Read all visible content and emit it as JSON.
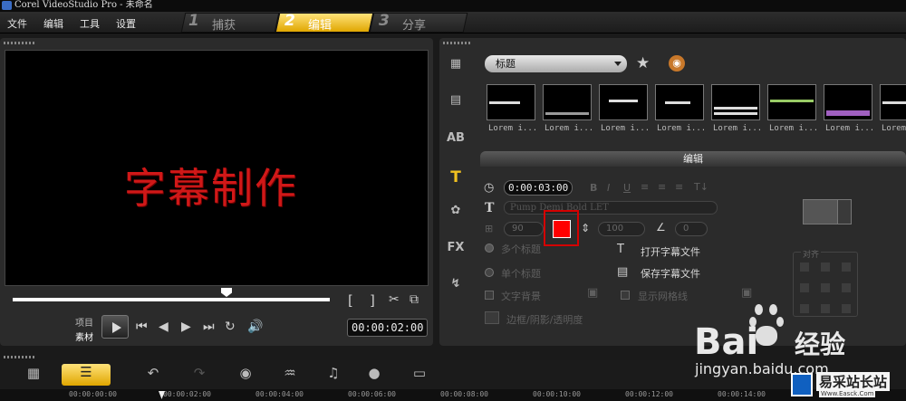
{
  "window": {
    "title": "Corel VideoStudio Pro - 未命名"
  },
  "menu": [
    "文件",
    "编辑",
    "工具",
    "设置"
  ],
  "steps": [
    {
      "num": "1",
      "label": "捕获",
      "active": false
    },
    {
      "num": "2",
      "label": "编辑",
      "active": true
    },
    {
      "num": "3",
      "label": "分享",
      "active": false
    }
  ],
  "preview": {
    "caption": "字幕制作",
    "labels": {
      "project": "项目",
      "clip": "素材"
    },
    "timecode": "00:00:02:00"
  },
  "library": {
    "dropdown": "标题",
    "thumb_labels": [
      "Lorem i...",
      "Lorem i...",
      "Lorem i...",
      "Lorem i...",
      "Lorem i...",
      "Lorem i...",
      "Lorem i...",
      "Lorem i..."
    ]
  },
  "edit": {
    "tab": "编辑",
    "duration": "0:00:03:00",
    "font": "Pump Demi Bold LET",
    "font_size": "90",
    "line_spacing": "100",
    "angle": "0",
    "text_color": "#ff0000",
    "multi_title": "多个标题",
    "single_title": "单个标题",
    "open_subtitle": "打开字幕文件",
    "save_subtitle": "保存字幕文件",
    "text_bg": "文字背景",
    "show_grid": "显示网格线",
    "border_shadow": "边框/阴影/透明度",
    "align": "对齐",
    "style_buttons": [
      "B",
      "I",
      "U"
    ]
  },
  "timeline": {
    "ruler": [
      "00:00:00:00",
      "00:00:02:00",
      "00:00:04:00",
      "00:00:06:00",
      "00:00:08:00",
      "00:00:10:00",
      "00:00:12:00",
      "00:00:14:00"
    ]
  },
  "watermark": {
    "baidu": "Bai",
    "jingyan": "经验",
    "url": "jingyan.baidu.com",
    "site": "易采站长站",
    "site_sub": "Www.Easck.Com"
  },
  "colors": {
    "accent": "#f0c020",
    "caption": "#d01818",
    "highlight_box": "#d40000"
  }
}
